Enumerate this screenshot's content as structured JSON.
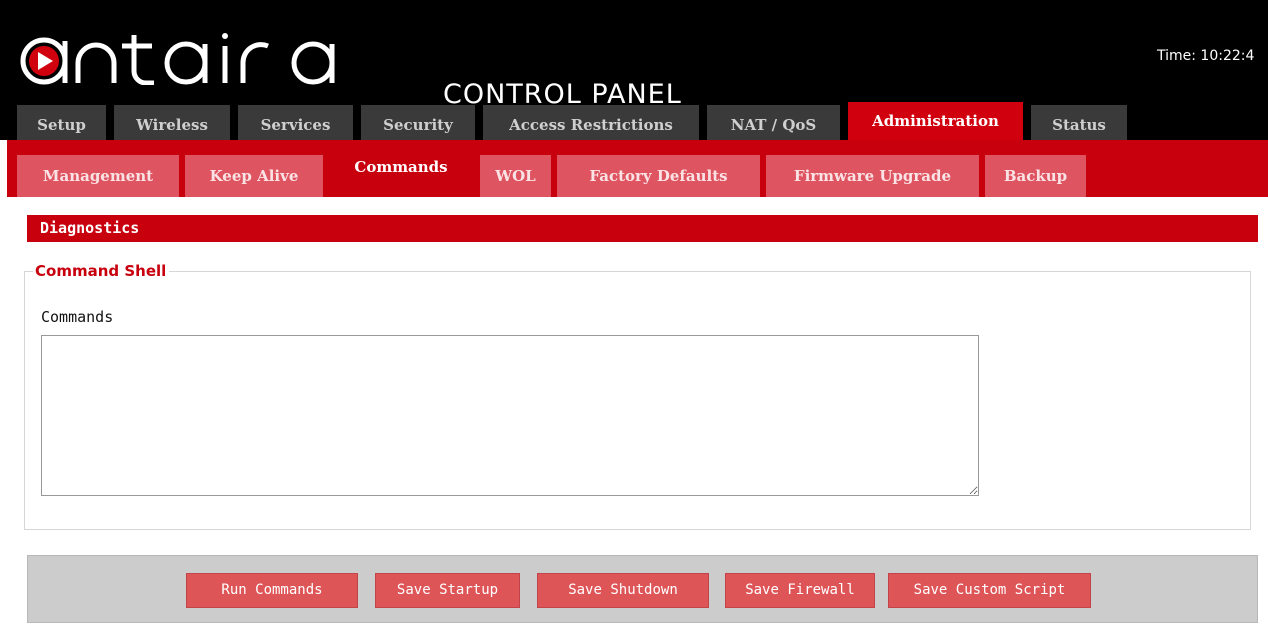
{
  "header": {
    "logo_text": "antaira",
    "subtitle": "CONTROL PANEL",
    "time": "Time: 10:22:4"
  },
  "main_tabs": [
    {
      "label": "Setup"
    },
    {
      "label": "Wireless"
    },
    {
      "label": "Services"
    },
    {
      "label": "Security"
    },
    {
      "label": "Access Restrictions"
    },
    {
      "label": "NAT / QoS"
    },
    {
      "label": "Administration",
      "active": true
    },
    {
      "label": "Status"
    }
  ],
  "sub_tabs": [
    {
      "label": "Management"
    },
    {
      "label": "Keep Alive"
    },
    {
      "label": "Commands",
      "active": true
    },
    {
      "label": "WOL"
    },
    {
      "label": "Factory Defaults"
    },
    {
      "label": "Firmware Upgrade"
    },
    {
      "label": "Backup"
    }
  ],
  "main": {
    "section_title": "Diagnostics",
    "fieldset_legend": "Command Shell",
    "commands_label": "Commands",
    "commands_value": ""
  },
  "buttons": {
    "run_commands": "Run Commands",
    "save_startup": "Save Startup",
    "save_shutdown": "Save Shutdown",
    "save_firewall": "Save Firewall",
    "save_custom_script": "Save Custom Script"
  },
  "colors": {
    "brand_red": "#c8000e",
    "tab_dark": "#3a3a3a",
    "button_red": "#de5558"
  }
}
